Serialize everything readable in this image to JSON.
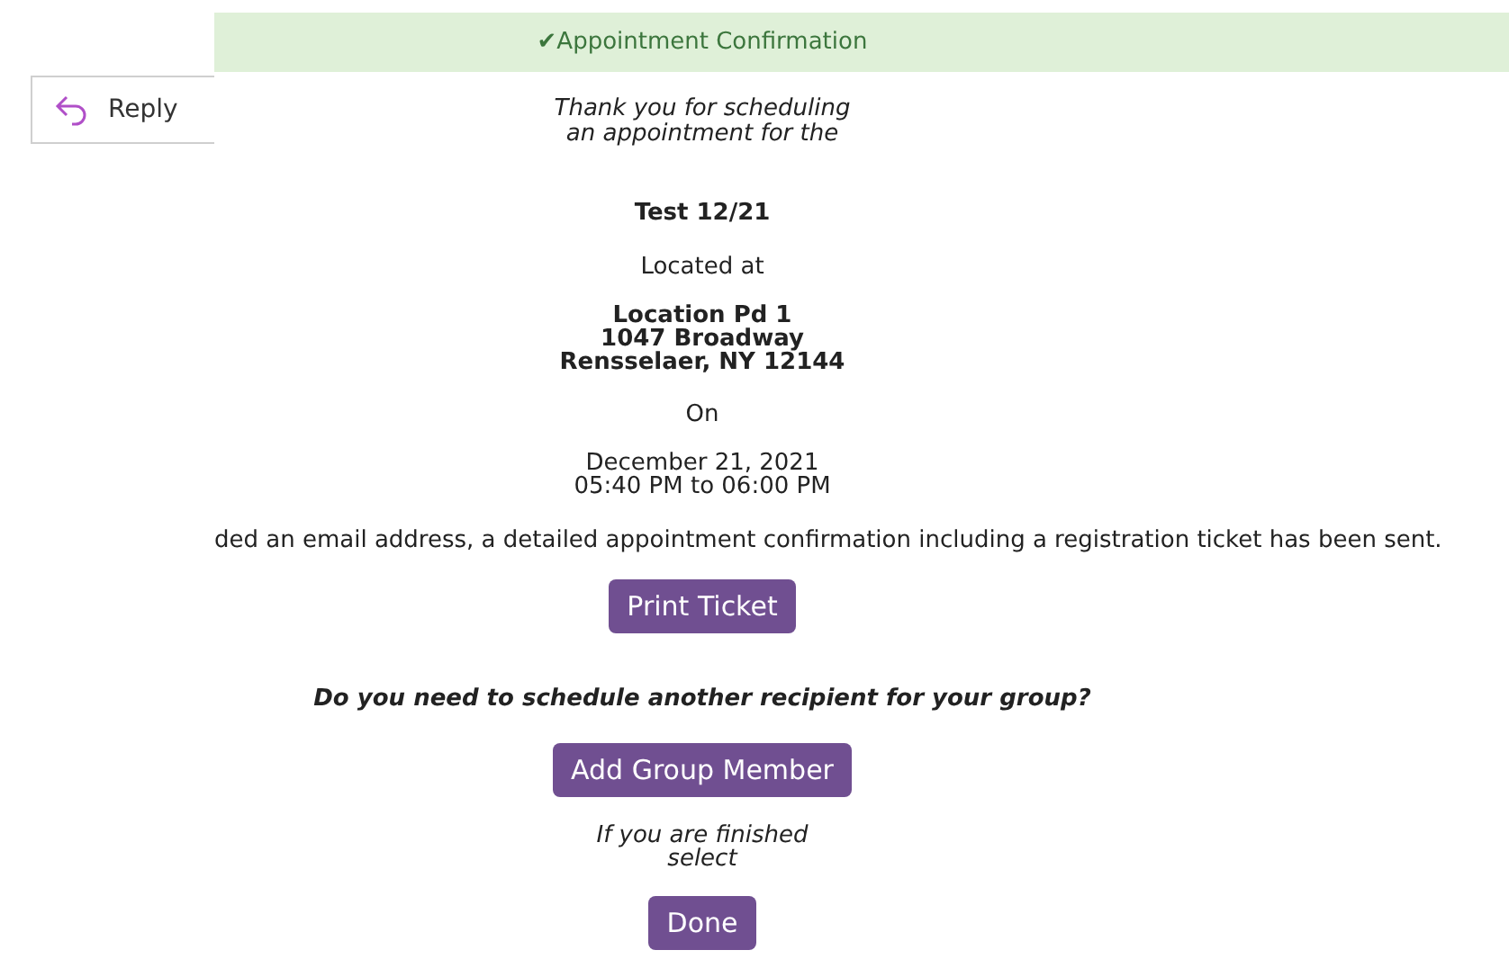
{
  "reply_button": {
    "label": "Reply"
  },
  "banner": {
    "icon": "✔",
    "title": "Appointment Confirmation"
  },
  "intro": "Thank you for scheduling an appointment for the",
  "event_name": "Test 12/21",
  "located_label": "Located at",
  "location_lines": [
    "Location Pd 1",
    "1047 Broadway",
    "Rensselaer, NY 12144"
  ],
  "on_label": "On",
  "date_lines": [
    "December 21, 2021",
    "05:40 PM to 06:00 PM"
  ],
  "email_notice": "ded an email address, a detailed appointment confirmation including a registration ticket has been sent.",
  "print_button": "Print Ticket",
  "group_question": "Do you need to schedule another recipient for your group?",
  "add_member_button": "Add Group Member",
  "finished_prompt": "If you are finished select",
  "done_button": "Done"
}
